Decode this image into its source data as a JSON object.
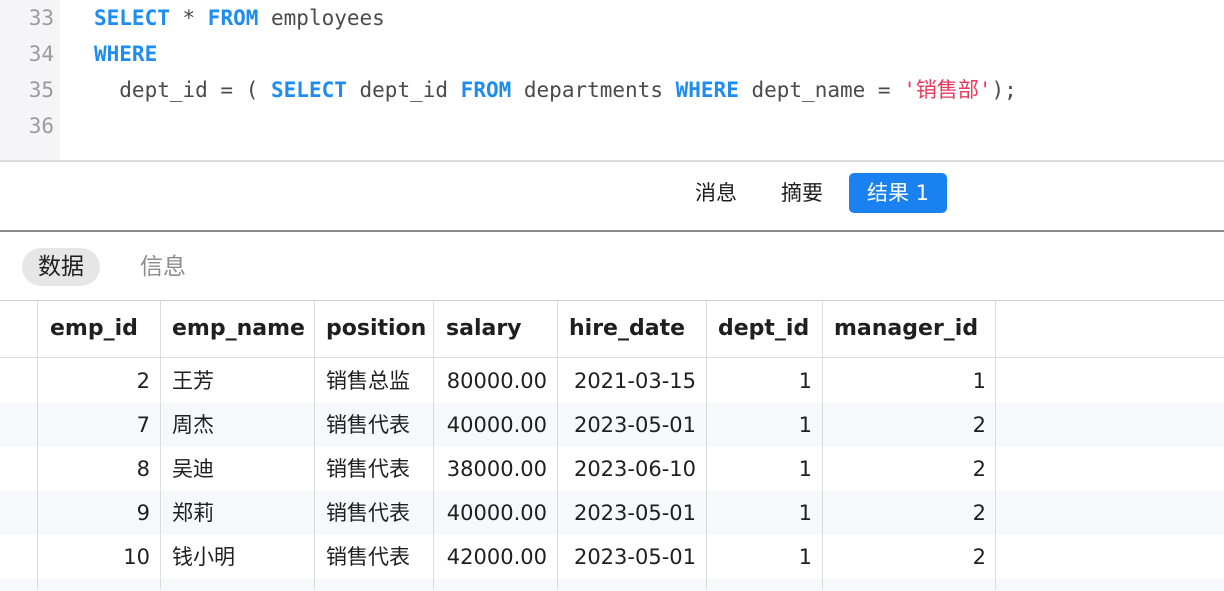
{
  "editor": {
    "lines": [
      {
        "no": "33",
        "tokens": [
          {
            "t": "SELECT",
            "k": "kw"
          },
          {
            "t": " * ",
            "k": ""
          },
          {
            "t": "FROM",
            "k": "kw"
          },
          {
            "t": " employees",
            "k": ""
          }
        ]
      },
      {
        "no": "34",
        "tokens": [
          {
            "t": "WHERE",
            "k": "kw"
          }
        ]
      },
      {
        "no": "35",
        "tokens": [
          {
            "t": "  dept_id = ( ",
            "k": ""
          },
          {
            "t": "SELECT",
            "k": "kw"
          },
          {
            "t": " dept_id ",
            "k": ""
          },
          {
            "t": "FROM",
            "k": "kw"
          },
          {
            "t": " departments ",
            "k": ""
          },
          {
            "t": "WHERE",
            "k": "kw"
          },
          {
            "t": " dept_name = ",
            "k": ""
          },
          {
            "t": "'销售部'",
            "k": "str"
          },
          {
            "t": ");",
            "k": ""
          }
        ]
      },
      {
        "no": "36",
        "tokens": []
      }
    ]
  },
  "result_tabs": {
    "messages": "消息",
    "summary": "摘要",
    "result1": "结果 1",
    "active": "result1"
  },
  "sub_tabs": {
    "data": "数据",
    "info": "信息",
    "active": "data"
  },
  "grid": {
    "columns": [
      "emp_id",
      "emp_name",
      "position",
      "salary",
      "hire_date",
      "dept_id",
      "manager_id"
    ],
    "rows": [
      [
        "2",
        "王芳",
        "销售总监",
        "80000.00",
        "2021-03-15",
        "1",
        "1"
      ],
      [
        "7",
        "周杰",
        "销售代表",
        "40000.00",
        "2023-05-01",
        "1",
        "2"
      ],
      [
        "8",
        "吴迪",
        "销售代表",
        "38000.00",
        "2023-06-10",
        "1",
        "2"
      ],
      [
        "9",
        "郑莉",
        "销售代表",
        "40000.00",
        "2023-05-01",
        "1",
        "2"
      ],
      [
        "10",
        "钱小明",
        "销售代表",
        "42000.00",
        "2023-05-01",
        "1",
        "2"
      ]
    ]
  },
  "colors": {
    "keyword": "#1f8cf0",
    "string": "#e8385c",
    "accent": "#1a82f0"
  }
}
